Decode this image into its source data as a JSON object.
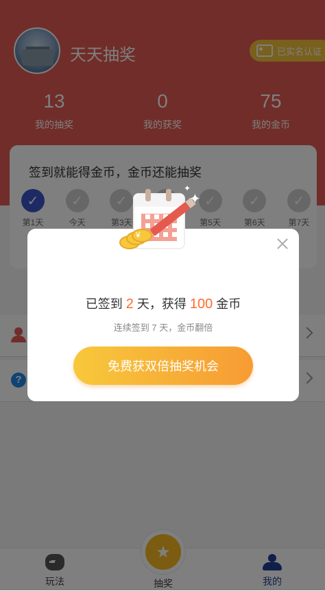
{
  "profile": {
    "username": "天天抽奖",
    "badge_label": "已实名认证"
  },
  "stats": [
    {
      "value": "13",
      "label": "我的抽奖"
    },
    {
      "value": "0",
      "label": "我的获奖"
    },
    {
      "value": "75",
      "label": "我的金币"
    }
  ],
  "sign_card": {
    "title": "签到就能得金币，金币还能抽奖",
    "days": [
      {
        "label": "第1天",
        "state": "checked"
      },
      {
        "label": "今天",
        "state": "unchecked"
      },
      {
        "label": "第3天",
        "state": "unchecked"
      },
      {
        "label": "",
        "state": "unchecked"
      },
      {
        "label": "第5天",
        "state": "unchecked"
      },
      {
        "label": "第6天",
        "state": "unchecked"
      },
      {
        "label": "第7天",
        "state": "unchecked"
      }
    ]
  },
  "tabs": [
    {
      "label": "玩法",
      "icon": "gamepad-icon"
    },
    {
      "label": "抽奖",
      "icon": "star-icon"
    },
    {
      "label": "我的",
      "icon": "user-icon"
    }
  ],
  "modal": {
    "message_prefix": "已签到",
    "days": "2",
    "message_middle": "天，获得",
    "coins": "100",
    "message_suffix": "金币",
    "sub": "连续签到 7 天，金币翻倍",
    "cta": "免费获双倍抽奖机会"
  },
  "colors": {
    "header": "#e25a53",
    "accent": "#ff6a2b",
    "badge": "#f2c13b",
    "active_tab": "#1f3f92",
    "check_active": "#3b55c8"
  }
}
